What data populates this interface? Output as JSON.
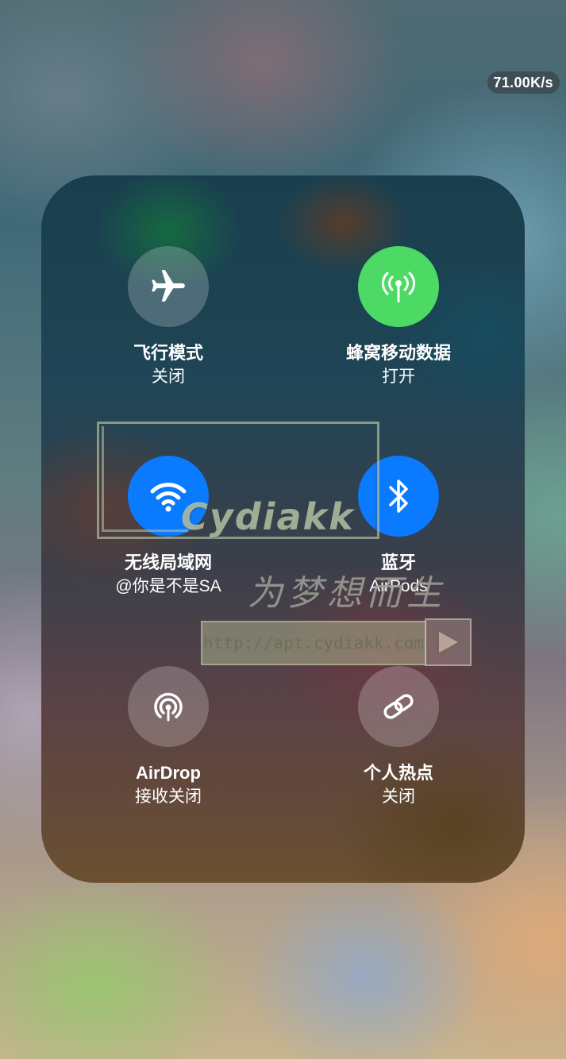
{
  "status": {
    "network_speed": "71.00K/s"
  },
  "tiles": [
    {
      "id": "airplane",
      "icon": "airplane-icon",
      "title": "飞行模式",
      "status": "关闭",
      "state": "off"
    },
    {
      "id": "cellular",
      "icon": "antenna-icon",
      "title": "蜂窝移动数据",
      "status": "打开",
      "state": "on",
      "color": "#4cd964"
    },
    {
      "id": "wifi",
      "icon": "wifi-icon",
      "title": "无线局域网",
      "status": "@你是不是SA",
      "state": "on",
      "color": "#0a7aff"
    },
    {
      "id": "bluetooth",
      "icon": "bluetooth-icon",
      "title": "蓝牙",
      "status": "AirPods",
      "state": "on",
      "color": "#0a7aff"
    },
    {
      "id": "airdrop",
      "icon": "airdrop-icon",
      "title": "AirDrop",
      "status": "接收关闭",
      "state": "off"
    },
    {
      "id": "hotspot",
      "icon": "link-icon",
      "title": "个人热点",
      "status": "关闭",
      "state": "off"
    }
  ],
  "watermark": {
    "logo": "Cydiakk",
    "script_text": "为梦想而生",
    "url": "http://apt.cydiakk.com",
    "play_icon": "play-icon"
  }
}
